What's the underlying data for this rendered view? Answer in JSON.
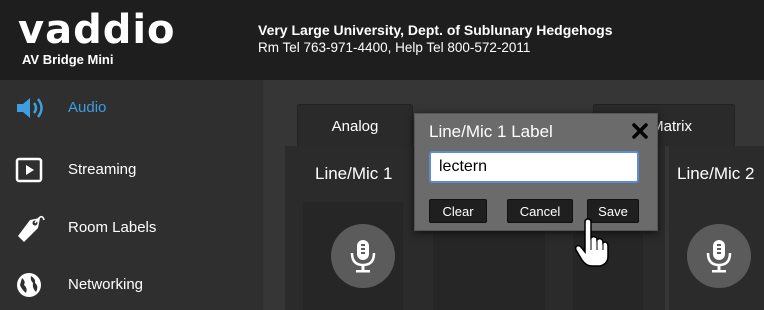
{
  "header": {
    "logo_word": "vaddio",
    "logo_sub": "AV Bridge Mini",
    "org_line1": "Very Large University, Dept. of Sublunary Hedgehogs",
    "org_line2": "Rm Tel 763-971-4400, Help Tel 800-572-2011"
  },
  "sidebar": {
    "items": [
      {
        "label": "Audio",
        "icon": "speaker-icon",
        "active": true
      },
      {
        "label": "Streaming",
        "icon": "play-box-icon",
        "active": false
      },
      {
        "label": "Room Labels",
        "icon": "tag-icon",
        "active": false
      },
      {
        "label": "Networking",
        "icon": "globe-icon",
        "active": false
      }
    ]
  },
  "main": {
    "tabs": [
      {
        "label": "Analog"
      },
      {
        "label": "Matrix"
      }
    ],
    "channels": [
      {
        "label": "Line/Mic 1"
      },
      {
        "label": "Line/Mic 2"
      }
    ]
  },
  "dialog": {
    "title": "Line/Mic 1 Label",
    "input_value": "lectern",
    "buttons": {
      "clear": "Clear",
      "cancel": "Cancel",
      "save": "Save"
    }
  },
  "colors": {
    "accent": "#3d9ee0",
    "header_bg": "#1e1e1e",
    "sidebar_bg": "#2f2f2f",
    "dialog_bg": "#6b6b6b"
  }
}
